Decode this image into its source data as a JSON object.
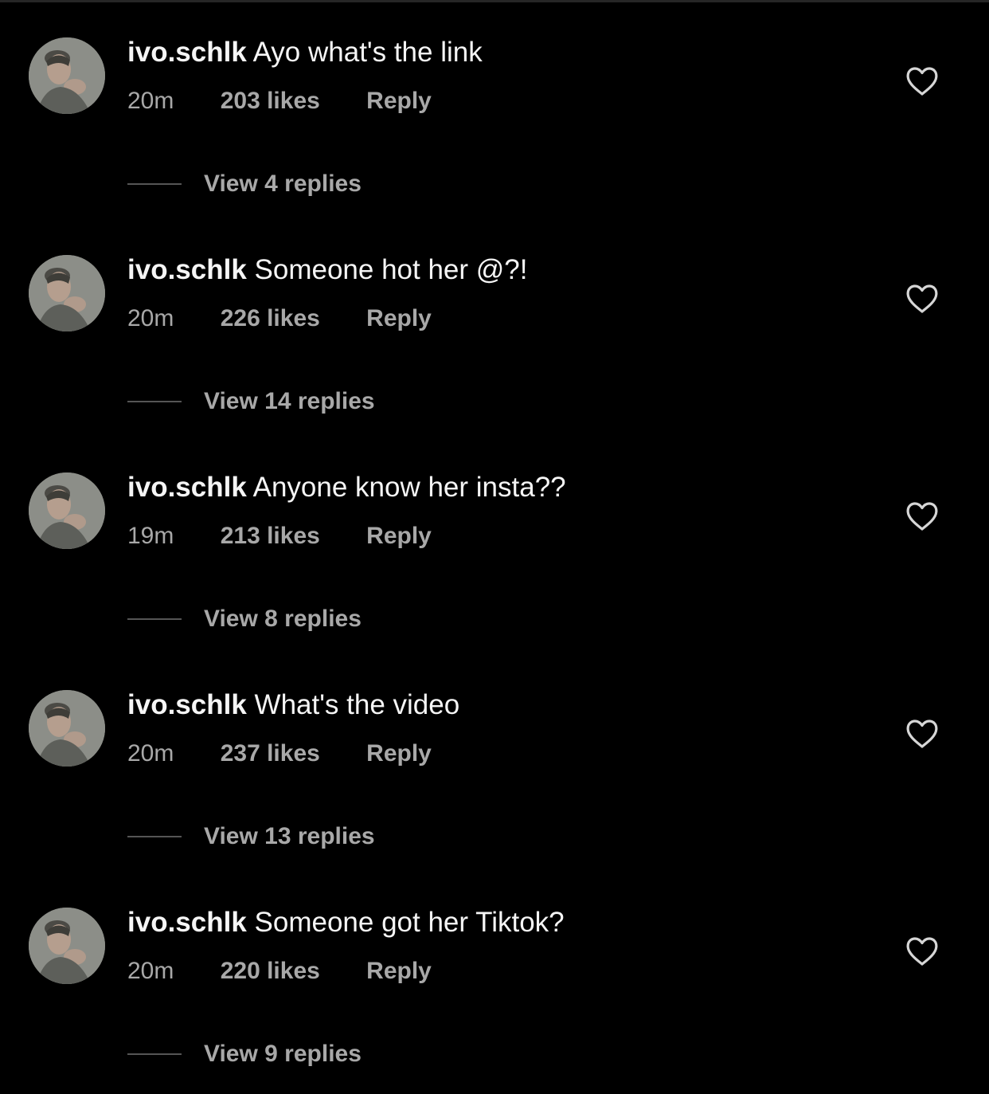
{
  "colors": {
    "background": "#000000",
    "primary_text": "#f5f5f5",
    "secondary_text": "#a8a8a8",
    "divider": "#555555"
  },
  "comments": [
    {
      "username": "ivo.schlk",
      "text": "Ayo what's the link",
      "time": "20m",
      "likes": "203 likes",
      "reply": "Reply",
      "view_replies": "View 4 replies",
      "like_icon": "heart-outline-icon"
    },
    {
      "username": "ivo.schlk",
      "text": "Someone hot her @?!",
      "time": "20m",
      "likes": "226 likes",
      "reply": "Reply",
      "view_replies": "View 14 replies",
      "like_icon": "heart-outline-icon"
    },
    {
      "username": "ivo.schlk",
      "text": "Anyone know her insta??",
      "time": "19m",
      "likes": "213 likes",
      "reply": "Reply",
      "view_replies": "View 8 replies",
      "like_icon": "heart-outline-icon"
    },
    {
      "username": "ivo.schlk",
      "text": "What's the video",
      "time": "20m",
      "likes": "237 likes",
      "reply": "Reply",
      "view_replies": "View 13 replies",
      "like_icon": "heart-outline-icon"
    },
    {
      "username": "ivo.schlk",
      "text": "Someone got her Tiktok?",
      "time": "20m",
      "likes": "220 likes",
      "reply": "Reply",
      "view_replies": "View 9 replies",
      "like_icon": "heart-outline-icon"
    }
  ]
}
